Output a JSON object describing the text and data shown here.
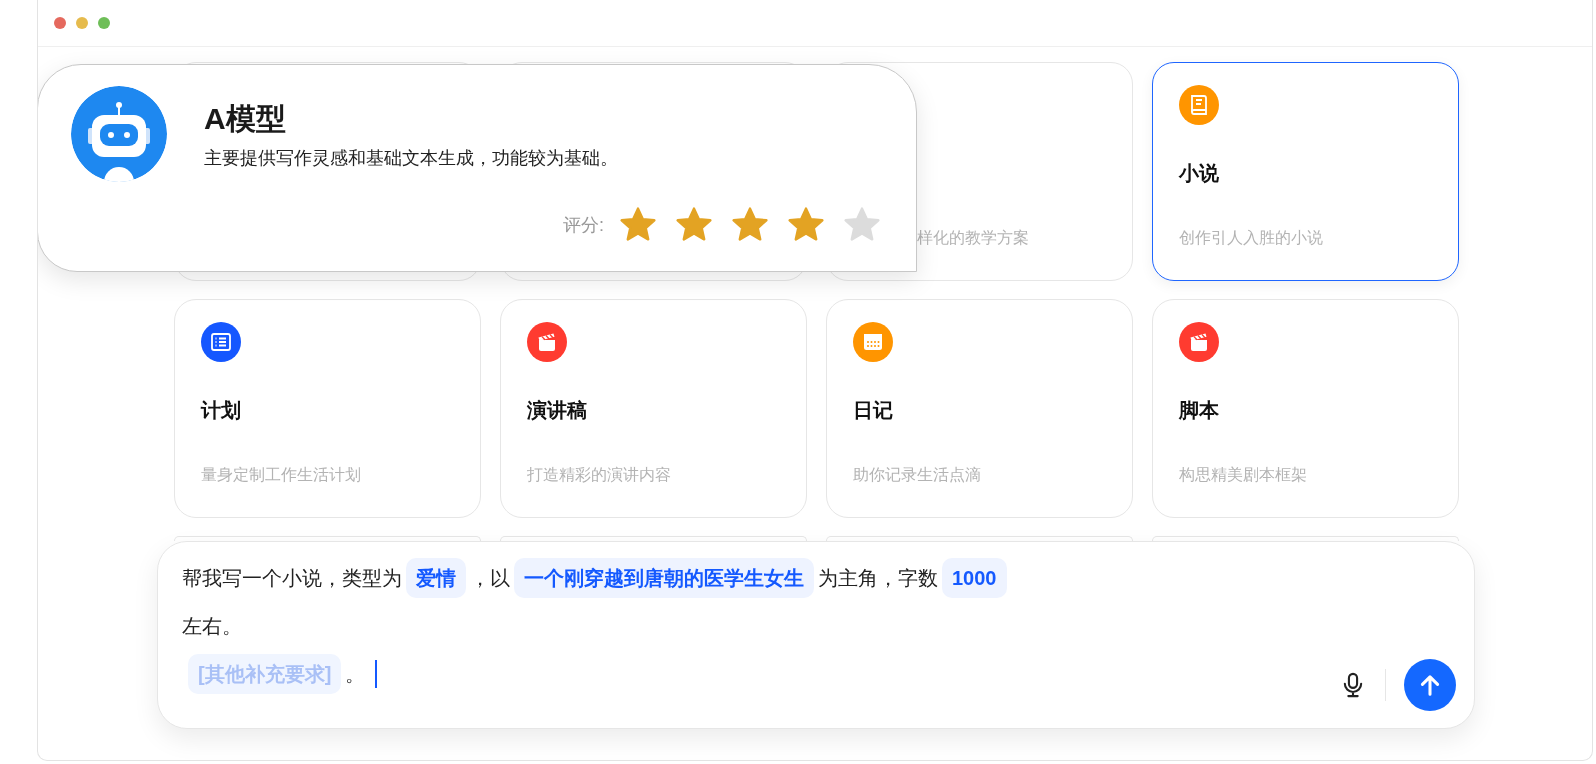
{
  "cards": [
    {
      "selected": false
    },
    {
      "selected": false
    },
    {
      "description": "样化的教学方案",
      "selected": false
    },
    {
      "kind": "book",
      "color": "#ff9500",
      "title": "小说",
      "description": "创作引人入胜的小说",
      "selected": true
    },
    {
      "kind": "list",
      "color": "#1557ff",
      "title": "计划",
      "description": "量身定制工作生活计划",
      "selected": false
    },
    {
      "kind": "clapper",
      "color": "#ff3b30",
      "title": "演讲稿",
      "description": "打造精彩的演讲内容",
      "selected": false
    },
    {
      "kind": "calendar",
      "color": "#ff9500",
      "title": "日记",
      "description": "助你记录生活点滴",
      "selected": false
    },
    {
      "kind": "clapper",
      "color": "#ff3b30",
      "title": "脚本",
      "description": "构思精美剧本框架",
      "selected": false
    },
    {
      "selected": false
    },
    {
      "selected": false
    },
    {
      "selected": false
    },
    {
      "selected": false
    }
  ],
  "model_popup": {
    "title": "A模型",
    "description": "主要提供写作灵感和基础文本生成，功能较为基础。",
    "rating_label": "评分:",
    "stars": 4
  },
  "prompt": {
    "lines": [
      [
        {
          "kind": "text",
          "text": "帮我写一个小说，类型为"
        },
        {
          "kind": "slot",
          "text": "爱情"
        },
        {
          "kind": "text",
          "text": "，以"
        },
        {
          "kind": "slot",
          "text": "一个刚穿越到唐朝的医学生女生"
        },
        {
          "kind": "text",
          "text": "为主角，字数"
        },
        {
          "kind": "slot",
          "text": "1000"
        }
      ],
      [
        {
          "kind": "text",
          "text": "左右。"
        }
      ],
      [
        {
          "kind": "placeholder",
          "text": "[其他补充要求]"
        },
        {
          "kind": "text",
          "text": "。"
        }
      ]
    ]
  }
}
